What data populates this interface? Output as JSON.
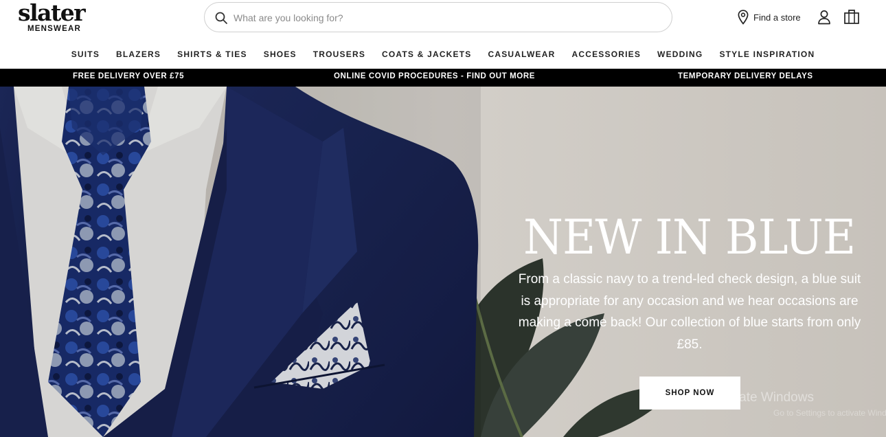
{
  "brand": {
    "logo_main": "slater",
    "logo_sub": "MENSWEAR"
  },
  "search": {
    "placeholder": "What are you looking for?",
    "value": ""
  },
  "header_actions": {
    "find_store_label": "Find a store",
    "icons": [
      "search-icon",
      "location-pin-icon",
      "account-icon",
      "shopping-bag-icon"
    ]
  },
  "nav": {
    "items": [
      {
        "label": "SUITS"
      },
      {
        "label": "BLAZERS"
      },
      {
        "label": "SHIRTS & TIES"
      },
      {
        "label": "SHOES"
      },
      {
        "label": "TROUSERS"
      },
      {
        "label": "COATS & JACKETS"
      },
      {
        "label": "CASUALWEAR"
      },
      {
        "label": "ACCESSORIES"
      },
      {
        "label": "WEDDING"
      },
      {
        "label": "STYLE INSPIRATION"
      }
    ]
  },
  "promo_bar": {
    "items": [
      {
        "label": "FREE DELIVERY OVER £75"
      },
      {
        "label": "ONLINE COVID PROCEDURES - FIND OUT MORE"
      },
      {
        "label": "TEMPORARY DELIVERY DELAYS"
      }
    ],
    "background": "#000000",
    "text_color": "#ffffff"
  },
  "hero": {
    "title": "NEW IN BLUE",
    "body": "From a classic navy to a trend-led check design, a blue suit is appropriate for any occasion and we hear occasions are making a come back! Our collection of blue starts from only £85.",
    "cta_label": "SHOP NOW",
    "colors": {
      "suit": "#1b2656",
      "background": "#cfcbc5"
    }
  },
  "os_watermark": {
    "title": "Activate Windows",
    "subtitle": "Go to Settings to activate Windows."
  }
}
